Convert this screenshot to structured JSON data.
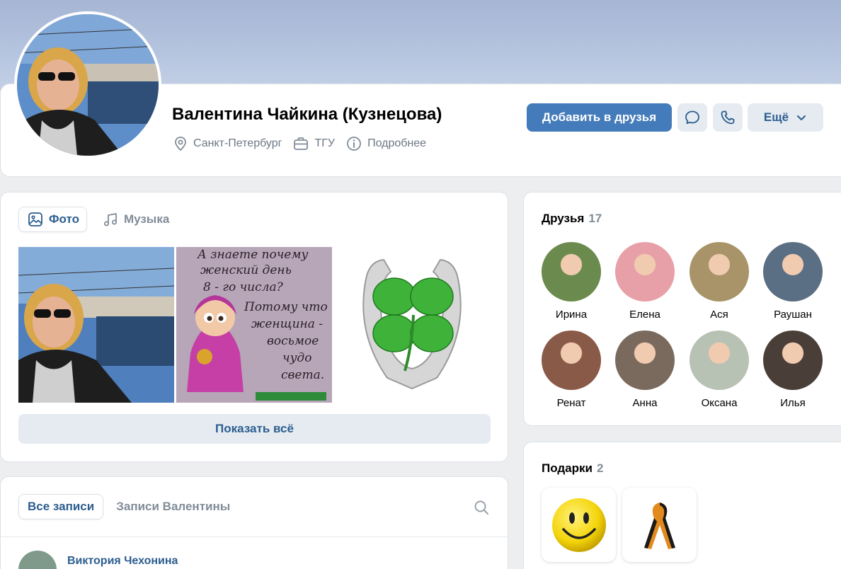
{
  "profile": {
    "name": "Валентина Чайкина (Кузнецова)",
    "city": "Санкт-Петербург",
    "university": "ТГУ",
    "details_label": "Подробнее",
    "add_friend_label": "Добавить в друзья",
    "more_label": "Ещё"
  },
  "media": {
    "tabs": [
      {
        "label": "Фото",
        "icon": "photo-icon",
        "active": true
      },
      {
        "label": "Музыка",
        "icon": "music-icon",
        "active": false
      }
    ],
    "photo2_lines": [
      "А знаете почему",
      "женский день",
      "8 - го числа?",
      "Потому что",
      "женщина -",
      "восьмое",
      "чудо",
      "света."
    ],
    "show_all_label": "Показать всё"
  },
  "wall": {
    "tabs": [
      {
        "label": "Все записи",
        "active": true
      },
      {
        "label": "Записи Валентины",
        "active": false
      }
    ],
    "post_author": "Виктория Чехонина"
  },
  "friends": {
    "title": "Друзья",
    "count": "17",
    "items": [
      {
        "name": "Ирина",
        "color": "#6b8a4e"
      },
      {
        "name": "Елена",
        "color": "#e8a0a8"
      },
      {
        "name": "Ася",
        "color": "#a89468"
      },
      {
        "name": "Раушан",
        "color": "#5a6e84"
      },
      {
        "name": "Ренат",
        "color": "#8a5a48"
      },
      {
        "name": "Анна",
        "color": "#7a6a5e"
      },
      {
        "name": "Оксана",
        "color": "#b8c2b4"
      },
      {
        "name": "Илья",
        "color": "#4a3e38"
      }
    ]
  },
  "gifts": {
    "title": "Подарки",
    "count": "2",
    "items": [
      {
        "icon": "smiley-icon"
      },
      {
        "icon": "ribbon-icon"
      }
    ]
  }
}
